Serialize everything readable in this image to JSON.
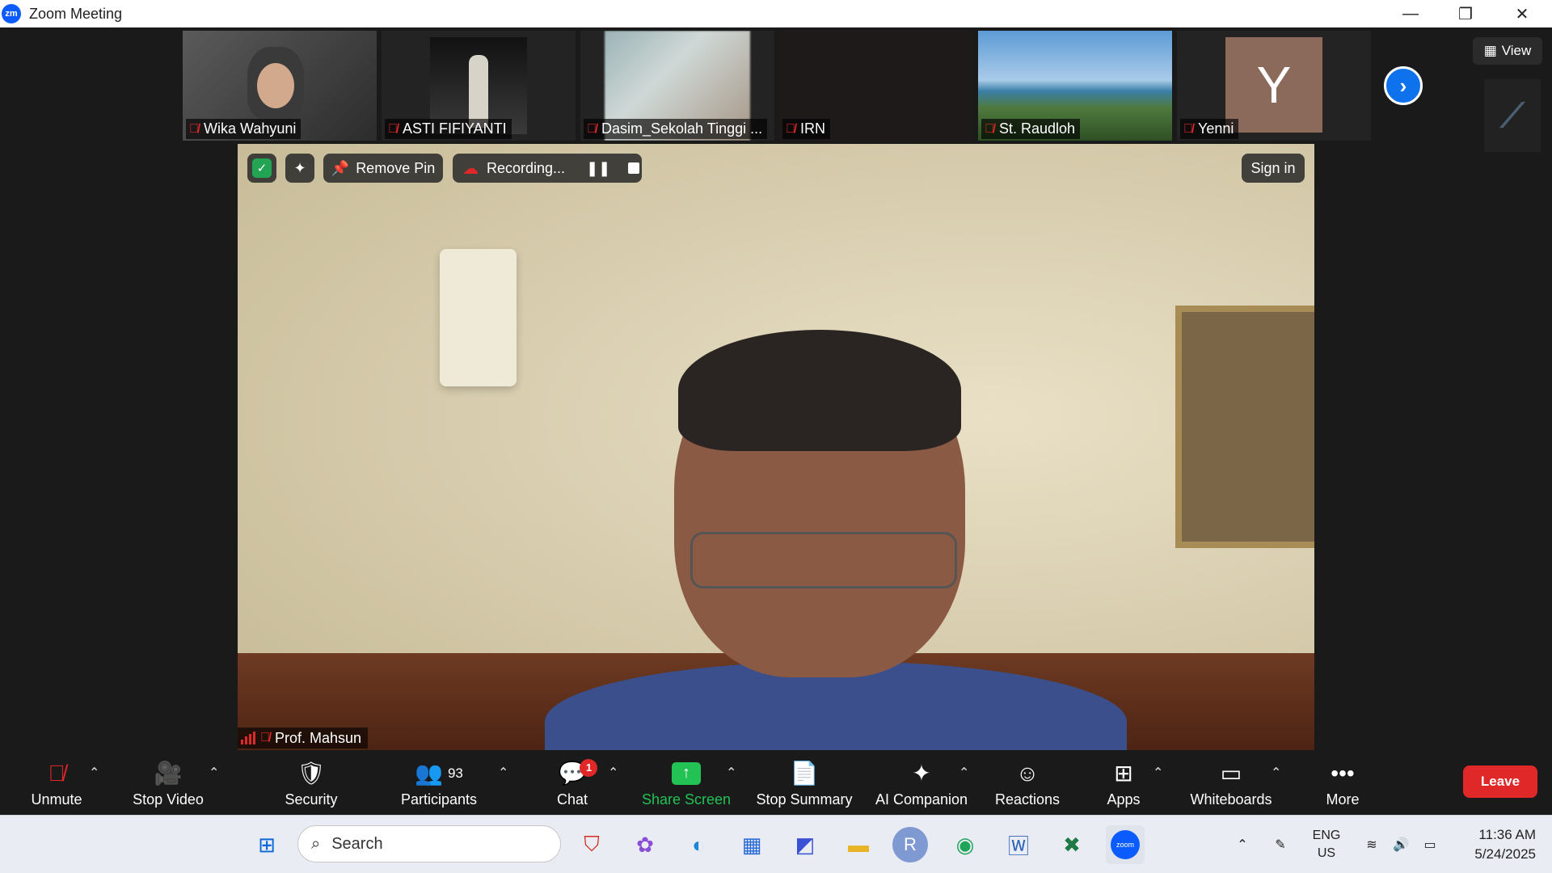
{
  "window": {
    "app_icon": "zm",
    "title": "Zoom Meeting",
    "min": "—",
    "restore": "❐",
    "close": "✕"
  },
  "thumbnails": [
    {
      "name": "Wika Wahyuni"
    },
    {
      "name": "ASTI FIFIYANTI"
    },
    {
      "name": "Dasim_Sekolah Tinggi ..."
    },
    {
      "name": "IRN"
    },
    {
      "name": "St. Raudloh"
    },
    {
      "name": "Yenni",
      "initial": "Y"
    }
  ],
  "view_button": "View",
  "main": {
    "remove_pin": "Remove Pin",
    "recording": "Recording...",
    "sign_in": "Sign in",
    "speaker_name": "Prof. Mahsun"
  },
  "toolbar": {
    "unmute": "Unmute",
    "stop_video": "Stop Video",
    "security": "Security",
    "participants": "Participants",
    "participants_count": "93",
    "chat": "Chat",
    "chat_badge": "1",
    "share_screen": "Share Screen",
    "stop_summary": "Stop Summary",
    "ai_companion": "AI Companion",
    "reactions": "Reactions",
    "apps": "Apps",
    "whiteboards": "Whiteboards",
    "more": "More",
    "leave": "Leave"
  },
  "taskbar": {
    "search_placeholder": "Search",
    "lang_top": "ENG",
    "lang_bottom": "US",
    "time": "11:36 AM",
    "date": "5/24/2025",
    "zoom_label": "zoom",
    "r_label": "R"
  },
  "colors": {
    "zoom_blue": "#0b5cff",
    "leave_red": "#e02828",
    "share_green": "#23c255"
  }
}
